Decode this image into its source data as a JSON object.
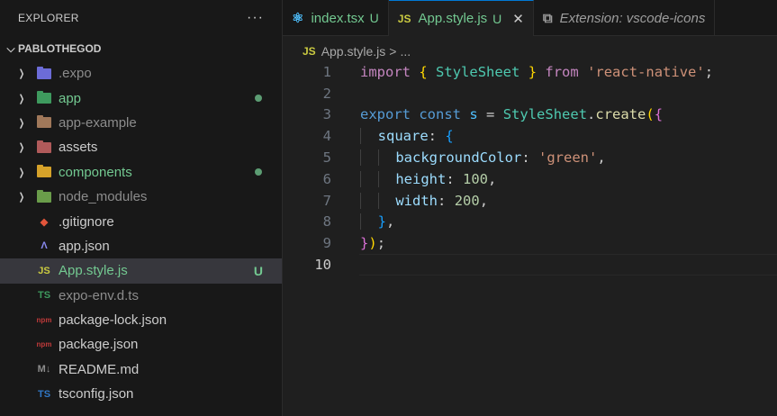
{
  "explorer": {
    "title": "EXPLORER",
    "more": "···",
    "root": "PABLOTHEGOD",
    "items": [
      {
        "name": ".expo",
        "type": "folder",
        "color": "gray",
        "icon": "expo-folder-icon",
        "iconColor": "#6c6cd8",
        "decoration": ""
      },
      {
        "name": "app",
        "type": "folder",
        "color": "green",
        "icon": "app-folder-icon",
        "iconColor": "#3e9a5e",
        "decoration": "dot"
      },
      {
        "name": "app-example",
        "type": "folder",
        "color": "gray",
        "icon": "folder-icon",
        "iconColor": "#a0785a",
        "decoration": ""
      },
      {
        "name": "assets",
        "type": "folder",
        "color": "white",
        "icon": "assets-folder-icon",
        "iconColor": "#b05a5a",
        "decoration": ""
      },
      {
        "name": "components",
        "type": "folder",
        "color": "green",
        "icon": "components-folder-icon",
        "iconColor": "#d6a22a",
        "decoration": "dot"
      },
      {
        "name": "node_modules",
        "type": "folder",
        "color": "gray",
        "icon": "node-modules-folder-icon",
        "iconColor": "#6a9c4a",
        "decoration": ""
      },
      {
        "name": ".gitignore",
        "type": "file",
        "color": "white",
        "icon": "git-icon",
        "glyph": "◆",
        "iconColor": "#e2553b",
        "decoration": ""
      },
      {
        "name": "app.json",
        "type": "file",
        "color": "white",
        "icon": "expo-icon",
        "glyph": "Λ",
        "iconColor": "#8a8af0",
        "decoration": ""
      },
      {
        "name": "App.style.js",
        "type": "file",
        "color": "green",
        "icon": "js-icon",
        "glyph": "JS",
        "iconColor": "#cbcb41",
        "decoration": "U",
        "selected": true
      },
      {
        "name": "expo-env.d.ts",
        "type": "file",
        "color": "gray",
        "icon": "typescript-def-icon",
        "glyph": "TS",
        "iconColor": "#3e9a5e",
        "decoration": ""
      },
      {
        "name": "package-lock.json",
        "type": "file",
        "color": "white",
        "icon": "npm-icon",
        "glyph": "npm",
        "iconColor": "#c03a3a",
        "decoration": ""
      },
      {
        "name": "package.json",
        "type": "file",
        "color": "white",
        "icon": "npm-icon",
        "glyph": "npm",
        "iconColor": "#c03a3a",
        "decoration": ""
      },
      {
        "name": "README.md",
        "type": "file",
        "color": "white",
        "icon": "markdown-icon",
        "glyph": "M↓",
        "iconColor": "#8c8c8c",
        "decoration": ""
      },
      {
        "name": "tsconfig.json",
        "type": "file",
        "color": "white",
        "icon": "tsconfig-icon",
        "glyph": "TS",
        "iconColor": "#3178c6",
        "decoration": ""
      }
    ]
  },
  "tabs": [
    {
      "label": "index.tsx",
      "icon": "react-icon",
      "glyph": "⚛",
      "iconColor": "#4fc1ff",
      "badge": "U",
      "active": false,
      "italic": false,
      "labelColor": "#73c991"
    },
    {
      "label": "App.style.js",
      "icon": "js-icon",
      "glyph": "JS",
      "iconColor": "#cbcb41",
      "badge": "U",
      "active": true,
      "italic": false,
      "labelColor": "#73c991",
      "close": "✕"
    },
    {
      "label": "Extension: vscode-icons",
      "icon": "extension-icon",
      "glyph": "⧉",
      "iconColor": "#9d9d9d",
      "badge": "",
      "active": false,
      "italic": true,
      "labelColor": "#9d9d9d"
    }
  ],
  "breadcrumb": {
    "icon": "JS",
    "file": "App.style.js",
    "sep": ">",
    "more": "..."
  },
  "code": {
    "current_line": 10,
    "lines": [
      [
        [
          "kw",
          "import"
        ],
        [
          "plain",
          " "
        ],
        [
          "p1",
          "{"
        ],
        [
          "plain",
          " "
        ],
        [
          "cls",
          "StyleSheet"
        ],
        [
          "plain",
          " "
        ],
        [
          "p1",
          "}"
        ],
        [
          "plain",
          " "
        ],
        [
          "kw",
          "from"
        ],
        [
          "plain",
          " "
        ],
        [
          "str",
          "'react-native'"
        ],
        [
          "plain",
          ";"
        ]
      ],
      [],
      [
        [
          "kw2",
          "export"
        ],
        [
          "plain",
          " "
        ],
        [
          "kw2",
          "const"
        ],
        [
          "plain",
          " "
        ],
        [
          "var",
          "s"
        ],
        [
          "plain",
          " = "
        ],
        [
          "cls",
          "StyleSheet"
        ],
        [
          "plain",
          "."
        ],
        [
          "fn",
          "create"
        ],
        [
          "p1",
          "("
        ],
        [
          "p2",
          "{"
        ]
      ],
      [
        [
          "guide",
          "  "
        ],
        [
          "prop",
          "square"
        ],
        [
          "plain",
          ": "
        ],
        [
          "p3",
          "{"
        ]
      ],
      [
        [
          "guide",
          "  "
        ],
        [
          "guide",
          "  "
        ],
        [
          "prop",
          "backgroundColor"
        ],
        [
          "plain",
          ": "
        ],
        [
          "str",
          "'green'"
        ],
        [
          "plain",
          ","
        ]
      ],
      [
        [
          "guide",
          "  "
        ],
        [
          "guide",
          "  "
        ],
        [
          "prop",
          "height"
        ],
        [
          "plain",
          ": "
        ],
        [
          "num",
          "100"
        ],
        [
          "plain",
          ","
        ]
      ],
      [
        [
          "guide",
          "  "
        ],
        [
          "guide",
          "  "
        ],
        [
          "prop",
          "width"
        ],
        [
          "plain",
          ": "
        ],
        [
          "num",
          "200"
        ],
        [
          "plain",
          ","
        ]
      ],
      [
        [
          "guide",
          "  "
        ],
        [
          "p3",
          "}"
        ],
        [
          "plain",
          ","
        ]
      ],
      [
        [
          "p2",
          "}"
        ],
        [
          "p1",
          ")"
        ],
        [
          "plain",
          ";"
        ]
      ],
      []
    ]
  }
}
